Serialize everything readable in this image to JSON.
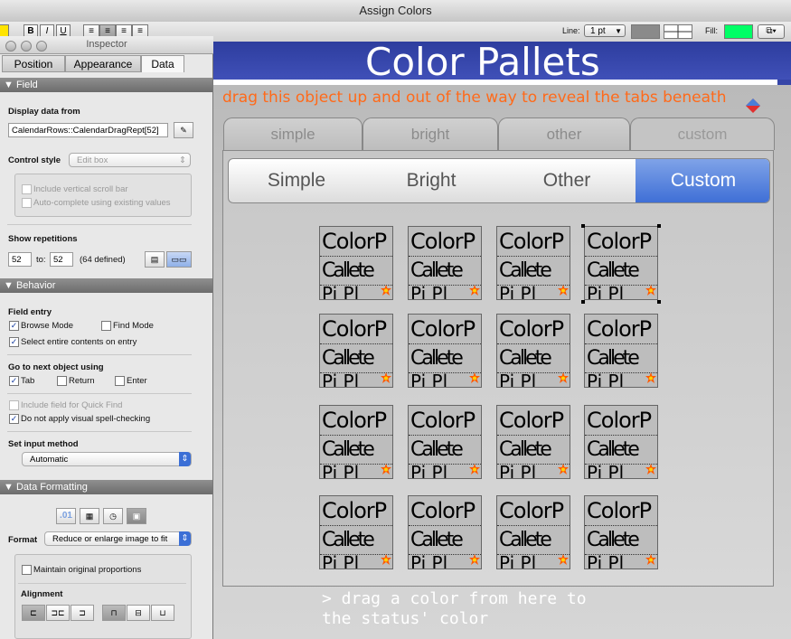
{
  "window": {
    "title": "Assign Colors"
  },
  "toolbar": {
    "bold": "B",
    "italic": "I",
    "underline": "U",
    "line_label": "Line:",
    "line_value": "1 pt",
    "fill_label": "Fill:",
    "fill_color": "#00ff66"
  },
  "inspector": {
    "title": "Inspector",
    "tabs": [
      {
        "label": "Position"
      },
      {
        "label": "Appearance"
      },
      {
        "label": "Data"
      }
    ],
    "field_section": {
      "header": "Field",
      "display_data_from_label": "Display data from",
      "display_data_from_value": "CalendarRows::CalendarDragRept[52]",
      "control_style_label": "Control style",
      "control_style_value": "Edit box",
      "include_scroll": "Include vertical scroll bar",
      "auto_complete": "Auto-complete using existing values",
      "show_repetitions_label": "Show repetitions",
      "rep_from": "52",
      "rep_to_label": "to:",
      "rep_to": "52",
      "rep_defined": "(64 defined)"
    },
    "behavior_section": {
      "header": "Behavior",
      "field_entry_label": "Field entry",
      "browse_mode": "Browse Mode",
      "find_mode": "Find Mode",
      "select_entire": "Select entire contents on entry",
      "go_to_next_label": "Go to next object using",
      "tab": "Tab",
      "return": "Return",
      "enter": "Enter",
      "quick_find": "Include field for Quick Find",
      "spell_check": "Do not apply visual spell-checking",
      "input_method_label": "Set input method",
      "input_method_value": "Automatic"
    },
    "data_formatting_section": {
      "header": "Data Formatting",
      "number_format_glyph": ".01",
      "format_label": "Format",
      "format_value": "Reduce or enlarge image to fit",
      "maintain_proportions": "Maintain original proportions",
      "alignment_label": "Alignment"
    }
  },
  "layout": {
    "title": "Color Pallets",
    "hint": "drag this object up and out of the way to reveal the tabs beneath",
    "tabs": [
      {
        "label": "simple"
      },
      {
        "label": "bright"
      },
      {
        "label": "other"
      },
      {
        "label": "custom"
      }
    ],
    "segments": [
      {
        "label": "Simple"
      },
      {
        "label": "Bright"
      },
      {
        "label": "Other"
      },
      {
        "label": "Custom"
      }
    ],
    "swatch": {
      "line1": "ColorP",
      "line2": "Callete",
      "line3": "Pi Pl"
    },
    "footer": "> drag a color from here to\nthe status' color"
  }
}
